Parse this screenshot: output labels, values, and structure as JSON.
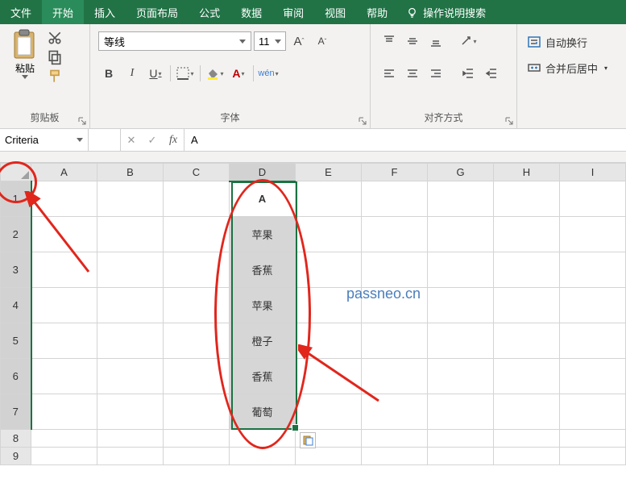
{
  "tabs": {
    "file": "文件",
    "home": "开始",
    "insert": "插入",
    "layout": "页面布局",
    "formulas": "公式",
    "data": "数据",
    "review": "审阅",
    "view": "视图",
    "help": "帮助",
    "search_hint": "操作说明搜索"
  },
  "ribbon": {
    "clipboard": {
      "paste": "粘贴",
      "group": "剪贴板"
    },
    "font": {
      "name": "等线",
      "size": "11",
      "group": "字体",
      "bold": "B",
      "italic": "I",
      "underline": "U",
      "ruby": "wén"
    },
    "align": {
      "group": "对齐方式"
    },
    "wrap": {
      "wrap_text": "自动换行",
      "merge_center": "合并后居中"
    }
  },
  "formula_bar": {
    "name": "Criteria",
    "fx": "fx",
    "value": "A"
  },
  "grid": {
    "cols": [
      "A",
      "B",
      "C",
      "D",
      "E",
      "F",
      "G",
      "H",
      "I"
    ],
    "rows": [
      "1",
      "2",
      "3",
      "4",
      "5",
      "6",
      "7",
      "8",
      "9"
    ],
    "d_values": [
      "A",
      "苹果",
      "香蕉",
      "苹果",
      "橙子",
      "香蕉",
      "葡萄"
    ]
  },
  "watermark": "passneo.cn"
}
